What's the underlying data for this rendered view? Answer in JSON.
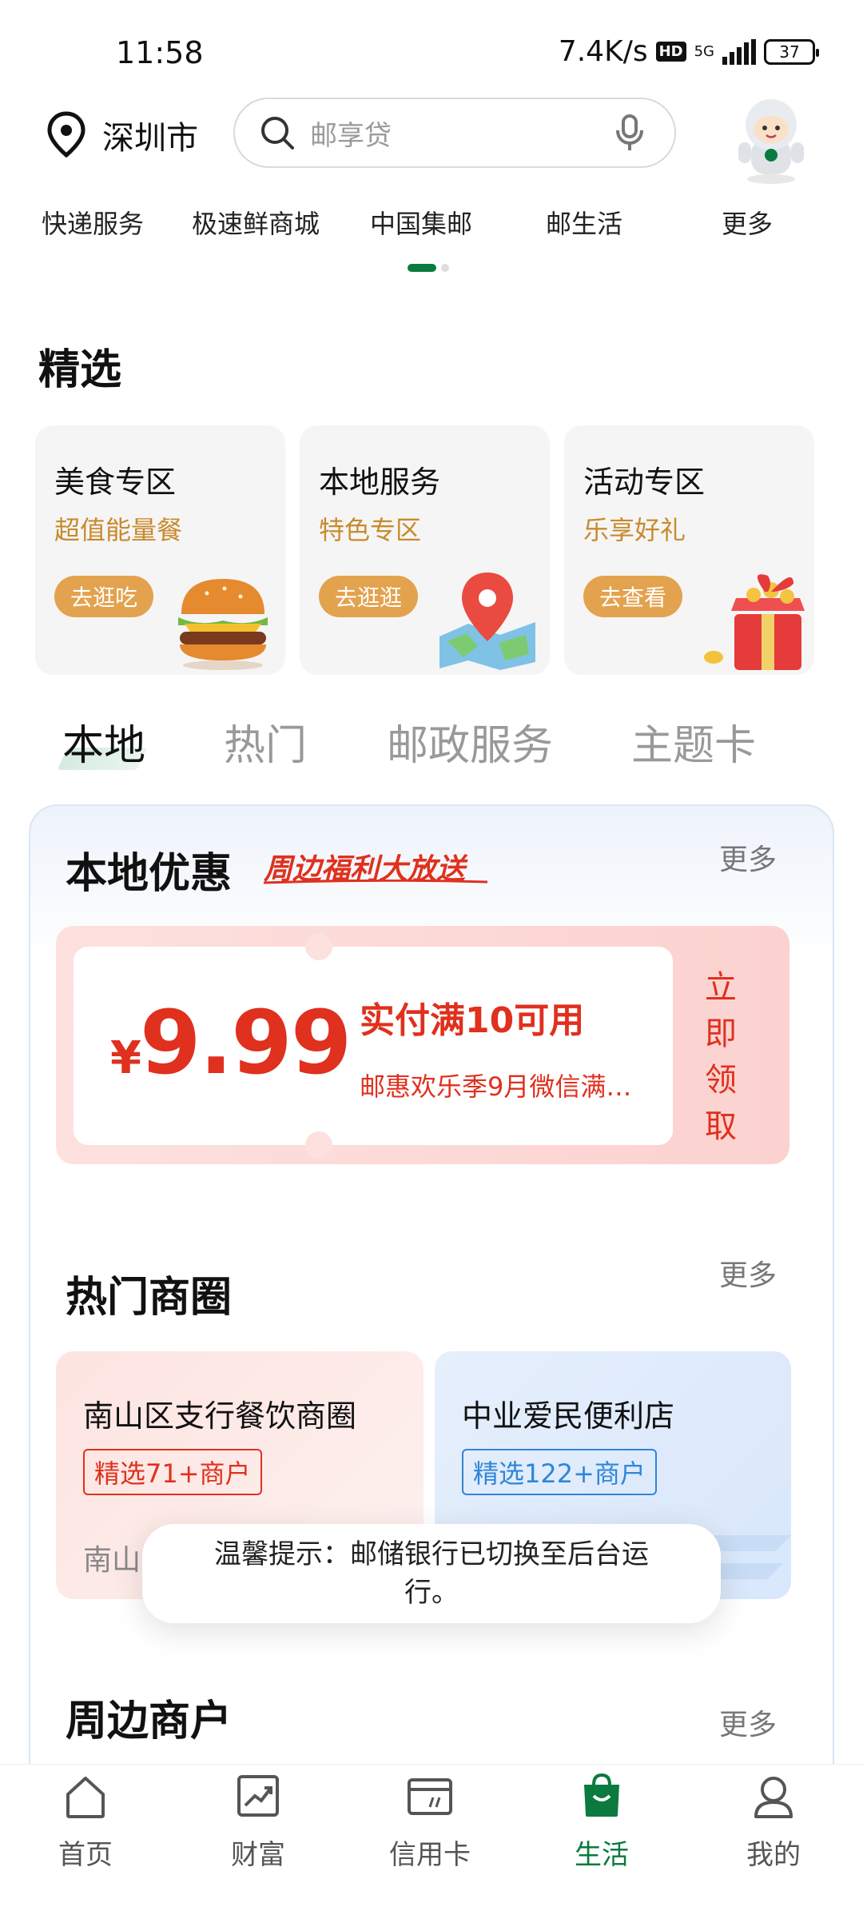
{
  "status": {
    "time": "11:58",
    "speed": "7.4K/s",
    "hd": "HD",
    "net": "5G",
    "battery": "37"
  },
  "header": {
    "city": "深圳市",
    "search_placeholder": "邮享贷"
  },
  "services": [
    "快递服务",
    "极速鲜商城",
    "中国集邮",
    "邮生活",
    "更多"
  ],
  "featured": {
    "title": "精选",
    "cards": [
      {
        "title": "美食专区",
        "subtitle": "超值能量餐",
        "button": "去逛吃",
        "icon": "burger-icon"
      },
      {
        "title": "本地服务",
        "subtitle": "特色专区",
        "button": "去逛逛",
        "icon": "map-pin-icon"
      },
      {
        "title": "活动专区",
        "subtitle": "乐享好礼",
        "button": "去查看",
        "icon": "gift-box-icon"
      }
    ]
  },
  "tabs": [
    "本地",
    "热门",
    "邮政服务",
    "主题卡"
  ],
  "active_tab": "本地",
  "local": {
    "title": "本地优惠",
    "slogan": "周边福利大放送",
    "more": "更多",
    "coupon": {
      "currency": "¥",
      "amount": "9.99",
      "condition": "实付满10可用",
      "description": "邮惠欢乐季9月微信满…",
      "claim": "立即领取"
    }
  },
  "hot": {
    "title": "热门商圈",
    "more": "更多",
    "cards": [
      {
        "title": "南山区支行餐饮商圈",
        "tag": "精选71+商户",
        "footer": "南山"
      },
      {
        "title": "中业爱民便利店",
        "tag": "精选122+商户",
        "footer": ""
      }
    ]
  },
  "toast": "温馨提示：邮储银行已切换至后台运行。",
  "nearby": {
    "title": "周边商户",
    "more": "更多"
  },
  "bottom_nav": [
    {
      "label": "首页",
      "icon": "home-icon"
    },
    {
      "label": "财富",
      "icon": "chart-icon"
    },
    {
      "label": "信用卡",
      "icon": "credit-card-icon"
    },
    {
      "label": "生活",
      "icon": "shopping-bag-icon"
    },
    {
      "label": "我的",
      "icon": "user-icon"
    }
  ],
  "colors": {
    "brand_green": "#0b7a3e",
    "accent_red": "#e0301e",
    "orange": "#e3a24e"
  }
}
